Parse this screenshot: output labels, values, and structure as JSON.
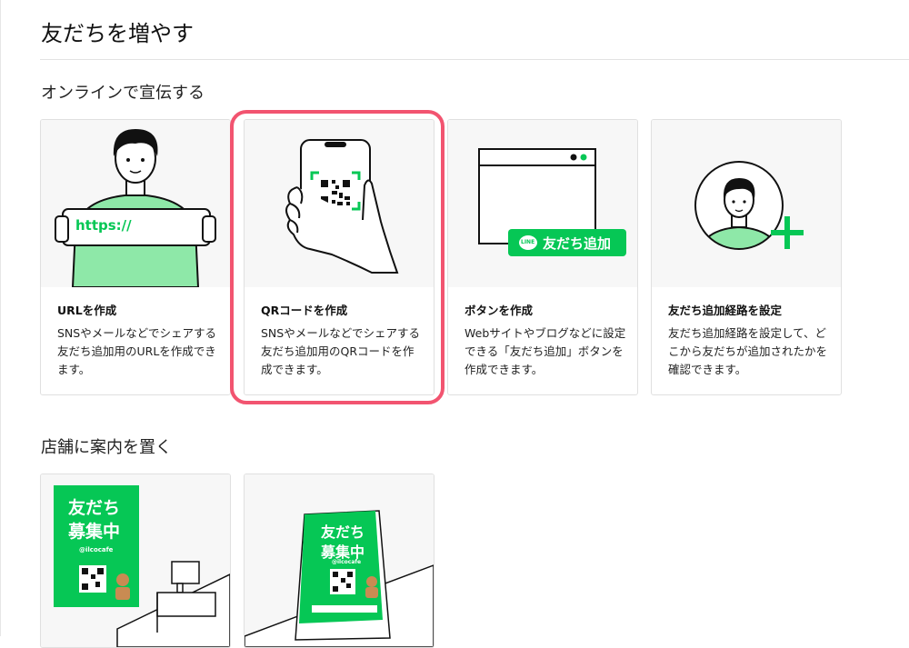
{
  "page": {
    "title": "友だちを増やす"
  },
  "sections": {
    "online": {
      "title": "オンラインで宣伝する"
    },
    "store": {
      "title": "店舗に案内を置く"
    }
  },
  "online_cards": [
    {
      "title": "URLを作成",
      "desc": "SNSやメールなどでシェアする友だち追加用のURLを作成できます。",
      "illus_text": "https://"
    },
    {
      "title": "QRコードを作成",
      "desc": "SNSやメールなどでシェアする友だち追加用のQRコードを作成できます。"
    },
    {
      "title": "ボタンを作成",
      "desc": "Webサイトやブログなどに設定できる「友だち追加」ボタンを作成できます。",
      "button_text": "友だち追加",
      "button_badge": "LINE"
    },
    {
      "title": "友だち追加経路を設定",
      "desc": "友だち追加経路を設定して、どこから友だちが追加されたかを確認できます。"
    }
  ],
  "store_cards": [
    {
      "poster_line1": "友だち",
      "poster_line2": "募集中",
      "poster_handle": "@ilcocafe"
    },
    {
      "poster_line1": "友だち",
      "poster_line2": "募集中",
      "poster_handle": "@ilcocafe"
    }
  ],
  "colors": {
    "line_green": "#06c755",
    "light_green": "#8ee8a8",
    "highlight_pink": "#f25470"
  }
}
